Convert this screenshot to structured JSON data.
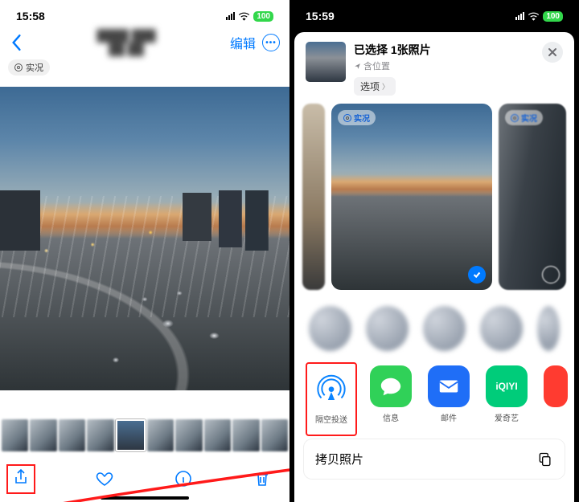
{
  "left": {
    "status_time": "15:58",
    "battery": "100",
    "edit": "编辑",
    "live_badge": "实况"
  },
  "right": {
    "status_time": "15:59",
    "battery": "100",
    "header_title": "已选择 1张照片",
    "header_location": "含位置",
    "options": "选项",
    "live_badge": "实况",
    "apps": {
      "airdrop": "隔空投送",
      "messages": "信息",
      "mail": "邮件",
      "iqiyi": "爱奇艺",
      "iqiyi_logo": "iQIYI"
    },
    "action_copy": "拷贝照片"
  }
}
